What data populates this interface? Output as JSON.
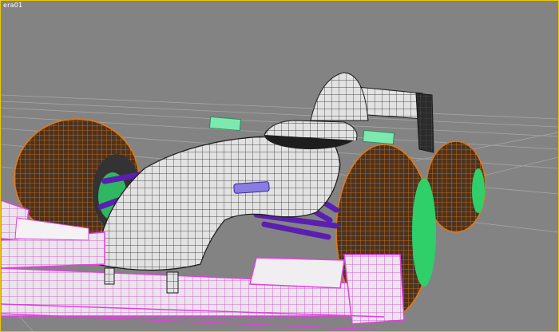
{
  "viewport": {
    "label": "era01",
    "border_color": "#e8c800",
    "background_color": "#838383"
  },
  "scene": {
    "subject": "formula-one-car-wireframe",
    "colors": {
      "body_shell": "#e4e4e4",
      "wire_mesh": "#1a1a1a",
      "tire_wire": "#e07818",
      "tire_dark": "#5a3a1e",
      "rim_green": "#2fcf6a",
      "front_wing_wire": "#e040e0",
      "wing_panel": "#f0eef0",
      "suspension": "#5a1fb0",
      "mirror": "#7de8b0",
      "grid_lines": "#a6a6a6"
    }
  }
}
